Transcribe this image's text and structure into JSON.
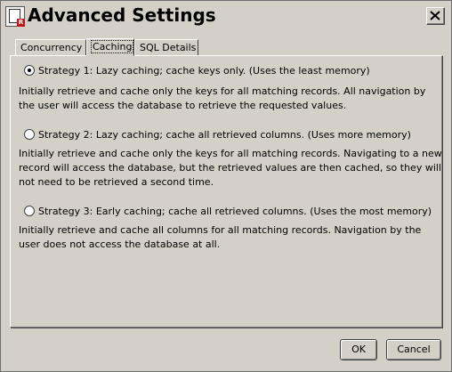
{
  "window": {
    "title": "Advanced Settings"
  },
  "tabs": [
    {
      "label": "Concurrency",
      "active": false
    },
    {
      "label": "Caching",
      "active": true
    },
    {
      "label": "SQL Details",
      "active": false
    }
  ],
  "strategies": [
    {
      "label": "Strategy 1: Lazy caching; cache keys only. (Uses the least memory)",
      "selected": true,
      "description": "Initially retrieve and cache only the keys for all matching records. All navigation by the user will access the database to retrieve the requested values."
    },
    {
      "label": "Strategy 2: Lazy caching; cache all retrieved columns. (Uses more memory)",
      "selected": false,
      "description": "Initially retrieve and cache only the keys for all matching records. Navigating to a new record will access the database, but the retrieved values are then cached, so they will not need to be retrieved a second time."
    },
    {
      "label": "Strategy 3: Early caching; cache all retrieved columns. (Uses the most memory)",
      "selected": false,
      "description": "Initially retrieve and cache all columns for all matching records. Navigation by the user does not access the database at all."
    }
  ],
  "buttons": {
    "ok": "OK",
    "cancel": "Cancel"
  }
}
